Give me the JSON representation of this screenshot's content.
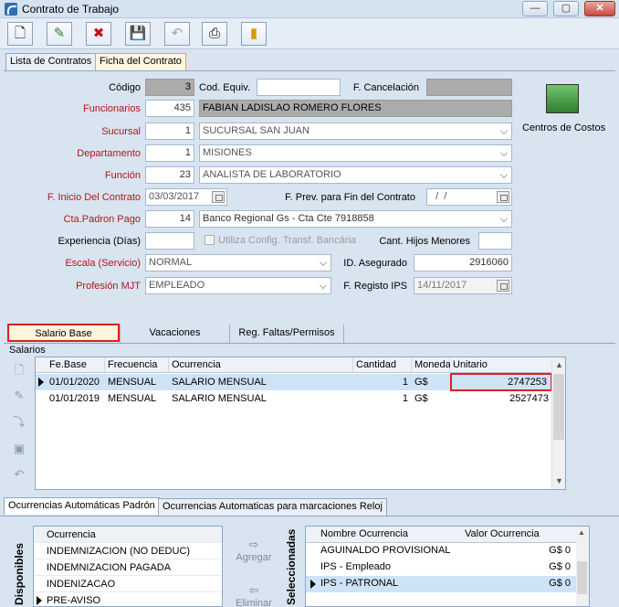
{
  "window": {
    "title": "Contrato de Trabajo",
    "btn_min": "—",
    "btn_max": "▢",
    "btn_close": "✕"
  },
  "toolbar": {
    "new": "🗋",
    "edit": "✎",
    "delete": "✖",
    "save": "💾",
    "undo": "↶",
    "print": "⎙",
    "exit": "▮"
  },
  "tabs": {
    "lista": "Lista de Contratos",
    "ficha": "Ficha del Contrato"
  },
  "form": {
    "codigo": {
      "label": "Código",
      "value": "3"
    },
    "cod_equiv": {
      "label": "Cod. Equiv.",
      "value": ""
    },
    "f_cancel": {
      "label": "F. Cancelación",
      "value": ""
    },
    "funcionarios": {
      "label": "Funcionarios",
      "code": "435",
      "name": "FABIAN LADISLAO ROMERO FLORES"
    },
    "sucursal": {
      "label": "Sucursal",
      "code": "1",
      "name": "SUCURSAL SAN JUAN"
    },
    "departamento": {
      "label": "Departamento",
      "code": "1",
      "name": "MISIONES"
    },
    "funcion": {
      "label": "Función",
      "code": "23",
      "name": "ANALISTA DE LABORATORIO"
    },
    "f_inicio": {
      "label": "F. Inicio Del Contrato",
      "value": "03/03/2017"
    },
    "f_prev": {
      "label": "F. Prev. para Fin del Contrato",
      "value": "  /  /"
    },
    "cta_padron": {
      "label": "Cta.Padron Pago",
      "code": "14",
      "name": "Banco Regional Gs - Cta Cte 7918858"
    },
    "experiencia": {
      "label": "Experiencia (Días)",
      "value": ""
    },
    "utiliza": {
      "label": "Utiliza Config. Transf. Bancária"
    },
    "hijos": {
      "label": "Cant. Hijos Menores",
      "value": ""
    },
    "escala": {
      "label": "Escala (Servicio)",
      "value": "NORMAL"
    },
    "id_asegurado": {
      "label": "ID. Asegurado",
      "value": "2916060"
    },
    "profesion": {
      "label": "Profesión MJT",
      "value": "EMPLEADO"
    },
    "f_registo": {
      "label": "F. Registo IPS",
      "value": "14/11/2017"
    },
    "centros": {
      "label": "Centros de Costos"
    }
  },
  "subtabs": {
    "salario": "Salario Base",
    "vacaciones": "Vacaciones",
    "faltas": "Reg. Faltas/Permisos"
  },
  "salarios": {
    "group_label": "Salarios",
    "headers": [
      "Fe.Base",
      "Frecuencia",
      "Ocurrencia",
      "Cantidad",
      "Moneda",
      "Unitario"
    ],
    "rows": [
      [
        "01/01/2020",
        "MENSUAL",
        "SALARIO MENSUAL",
        "1",
        "G$",
        "2747253"
      ],
      [
        "01/01/2019",
        "MENSUAL",
        "SALARIO MENSUAL",
        "1",
        "G$",
        "2527473"
      ]
    ]
  },
  "bottom": {
    "tab1": "Ocurrencias Automáticas Padrón",
    "tab2": "Ocurrencias Automaticas para marcaciones Reloj",
    "disponibles": "Disponibles",
    "seleccionadas": "Seleccionadas",
    "ocurrencia_header": "Ocurrencia",
    "disp_items": [
      "INDEMNIZACION (NO DEDUC)",
      "INDEMNIZACION PAGADA",
      "INDENIZACAO",
      "PRE-AVISO"
    ],
    "agregar": "Agregar",
    "eliminar": "Eliminar",
    "sel_headers": [
      "Nombre Ocurrencia",
      "Valor Ocurrencia"
    ],
    "sel_items": [
      [
        "AGUINALDO PROVISIONAL",
        "G$ 0"
      ],
      [
        "IPS - Empleado",
        "G$ 0"
      ],
      [
        "IPS - PATRONAL",
        "G$ 0"
      ]
    ]
  }
}
